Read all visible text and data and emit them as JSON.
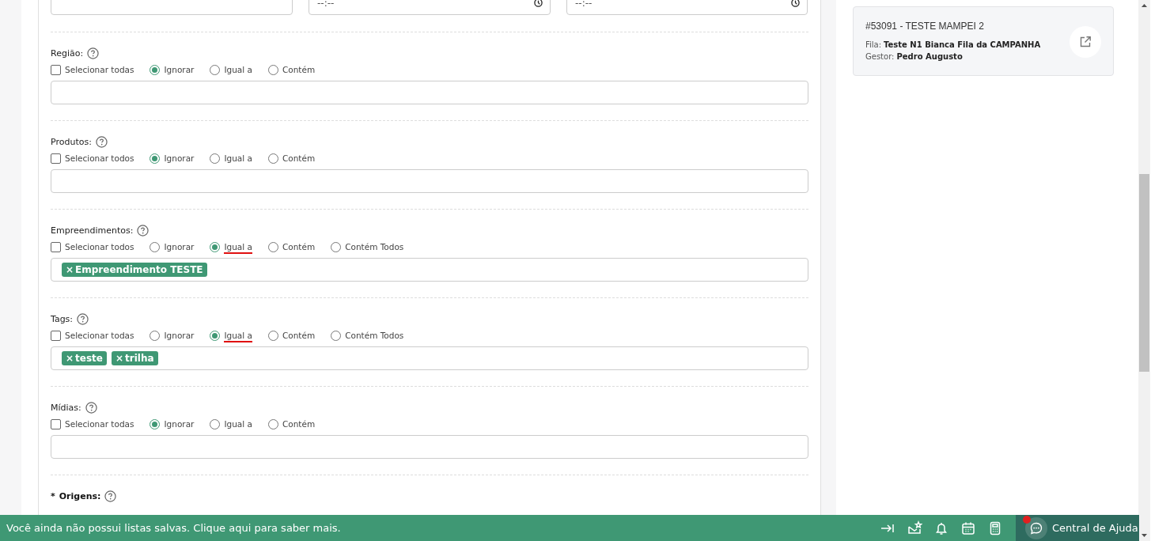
{
  "top_fields": [
    {
      "kind": "text"
    },
    {
      "kind": "time",
      "placeholder": "--:--"
    },
    {
      "kind": "time",
      "placeholder": "--:--"
    }
  ],
  "filters": [
    {
      "label": "Região:",
      "required": false,
      "options": [
        {
          "kind": "checkbox",
          "label": "Selecionar todas",
          "checked": false
        },
        {
          "kind": "radio",
          "label": "Ignorar",
          "selected": true,
          "underlined": false
        },
        {
          "kind": "radio",
          "label": "Igual a",
          "selected": false,
          "underlined": false
        },
        {
          "kind": "radio",
          "label": "Contém",
          "selected": false,
          "underlined": false
        }
      ]
    },
    {
      "label": "Produtos:",
      "required": false,
      "options": [
        {
          "kind": "checkbox",
          "label": "Selecionar todos",
          "checked": false
        },
        {
          "kind": "radio",
          "label": "Ignorar",
          "selected": true,
          "underlined": false
        },
        {
          "kind": "radio",
          "label": "Igual a",
          "selected": false,
          "underlined": false
        },
        {
          "kind": "radio",
          "label": "Contém",
          "selected": false,
          "underlined": false
        }
      ]
    },
    {
      "label": "Empreendimentos:",
      "required": false,
      "options": [
        {
          "kind": "checkbox",
          "label": "Selecionar todos",
          "checked": false
        },
        {
          "kind": "radio",
          "label": "Ignorar",
          "selected": false,
          "underlined": false
        },
        {
          "kind": "radio",
          "label": "Igual a",
          "selected": true,
          "underlined": true
        },
        {
          "kind": "radio",
          "label": "Contém",
          "selected": false,
          "underlined": false
        },
        {
          "kind": "radio",
          "label": "Contém Todos",
          "selected": false,
          "underlined": false
        }
      ],
      "tags": [
        {
          "remove": "×",
          "label": "Empreendimento TESTE"
        }
      ]
    },
    {
      "label": "Tags:",
      "required": false,
      "options": [
        {
          "kind": "checkbox",
          "label": "Selecionar todas",
          "checked": false
        },
        {
          "kind": "radio",
          "label": "Ignorar",
          "selected": false,
          "underlined": false
        },
        {
          "kind": "radio",
          "label": "Igual a",
          "selected": true,
          "underlined": true
        },
        {
          "kind": "radio",
          "label": "Contém",
          "selected": false,
          "underlined": false
        },
        {
          "kind": "radio",
          "label": "Contém Todos",
          "selected": false,
          "underlined": false
        }
      ],
      "tags": [
        {
          "remove": "×",
          "label": "teste"
        },
        {
          "remove": "×",
          "label": "trilha"
        }
      ]
    },
    {
      "label": "Mídias:",
      "required": false,
      "options": [
        {
          "kind": "checkbox",
          "label": "Selecionar todas",
          "checked": false
        },
        {
          "kind": "radio",
          "label": "Ignorar",
          "selected": true,
          "underlined": false
        },
        {
          "kind": "radio",
          "label": "Igual a",
          "selected": false,
          "underlined": false
        },
        {
          "kind": "radio",
          "label": "Contém",
          "selected": false,
          "underlined": false
        }
      ]
    },
    {
      "label": "Origens:",
      "required": true,
      "required_mark": "*"
    }
  ],
  "card": {
    "title": "#53091 - TESTE MAMPEI 2",
    "lines": [
      {
        "label": "Fila:",
        "value": "Teste N1 Bianca Fila da CAMPANHA"
      },
      {
        "label": "Gestor:",
        "value": "Pedro Augusto"
      }
    ]
  },
  "bottom_bar": {
    "message": "Você ainda não possui listas salvas. Clique aqui para saber mais.",
    "help_label": "Central de Ajuda",
    "help_notification": true
  }
}
